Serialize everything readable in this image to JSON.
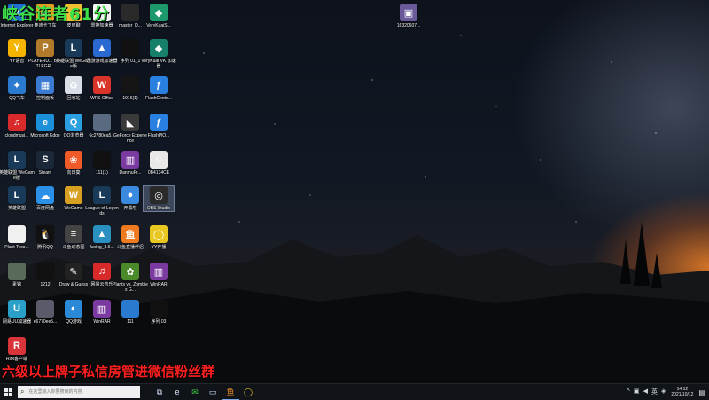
{
  "overlay": {
    "title": "峡谷连者61分",
    "banner": "六级以上牌子私信房管进微信粉丝群"
  },
  "desktop_icons": [
    {
      "label": "Internet Explorer",
      "icon": "ie-icon",
      "color": "#1f6fd0",
      "glyph": "e"
    },
    {
      "label": "奥迪卡丁车",
      "icon": "kart-icon",
      "color": "#e0a020",
      "glyph": "◉"
    },
    {
      "label": "皮皮聊",
      "icon": "chat-icon",
      "color": "#f0c030",
      "glyph": "☺"
    },
    {
      "label": "雷神加速器",
      "icon": "thor-icon",
      "color": "#f5f5f5",
      "glyph": "⚡"
    },
    {
      "label": "master_D...",
      "icon": "file-icon",
      "color": "#2a2a2a",
      "glyph": ""
    },
    {
      "label": "VeryKuaiS...",
      "icon": "verykuai-icon",
      "color": "#1d9a6c",
      "glyph": "◆"
    },
    {
      "label": "YY语音",
      "icon": "yy-icon",
      "color": "#f4b400",
      "glyph": "Y"
    },
    {
      "label": "PLAYERU... BATTLEGR...",
      "icon": "pubg-icon",
      "color": "#b07a2a",
      "glyph": "P"
    },
    {
      "label": "英雄联盟 WeGame版",
      "icon": "lol-icon",
      "color": "#1a3a5a",
      "glyph": "L"
    },
    {
      "label": "迅游游戏加速器",
      "icon": "xunyou-icon",
      "color": "#2a6ad0",
      "glyph": "▲"
    },
    {
      "label": "序列 01_1",
      "icon": "video-icon",
      "color": "#111111",
      "glyph": ""
    },
    {
      "label": "VeryKuai VK 加速器",
      "icon": "vk-icon",
      "color": "#17806a",
      "glyph": "◆"
    },
    {
      "label": "QQ飞车",
      "icon": "qqspeed-icon",
      "color": "#2a7ad0",
      "glyph": "✦"
    },
    {
      "label": "控制面板",
      "icon": "control-panel-icon",
      "color": "#3a7ad0",
      "glyph": "▦"
    },
    {
      "label": "回收站",
      "icon": "recycle-bin-icon",
      "color": "#d8dde6",
      "glyph": "♻"
    },
    {
      "label": "WPS Office",
      "icon": "wps-icon",
      "color": "#d8342a",
      "glyph": "W"
    },
    {
      "label": "1916(1)",
      "icon": "video-icon",
      "color": "#151515",
      "glyph": ""
    },
    {
      "label": "FlashCente...",
      "icon": "flash-icon",
      "color": "#2a80e0",
      "glyph": "ƒ"
    },
    {
      "label": "cloudmusi...",
      "icon": "netease-music-icon",
      "color": "#d82a2a",
      "glyph": "♫"
    },
    {
      "label": "Microsoft Edge",
      "icon": "edge-icon",
      "color": "#1b8fd8",
      "glyph": "e"
    },
    {
      "label": "QQ浏览器",
      "icon": "qqbrowser-icon",
      "color": "#2aa0e0",
      "glyph": "Q"
    },
    {
      "label": "6c2780ea5...",
      "icon": "image-icon",
      "color": "#5a6a80",
      "glyph": ""
    },
    {
      "label": "GeForce Experience",
      "icon": "geforce-icon",
      "color": "#3a3a3a",
      "glyph": "◣"
    },
    {
      "label": "FlashPlQ...",
      "icon": "flash-icon",
      "color": "#2a80e0",
      "glyph": "ƒ"
    },
    {
      "label": "英雄联盟 WeGame版",
      "icon": "lol-icon",
      "color": "#1a3a5a",
      "glyph": "L"
    },
    {
      "label": "Steam",
      "icon": "steam-icon",
      "color": "#1b2838",
      "glyph": "S"
    },
    {
      "label": "向日葵",
      "icon": "sunlogin-icon",
      "color": "#f05a28",
      "glyph": "❀"
    },
    {
      "label": "111(1)",
      "icon": "video-icon",
      "color": "#111111",
      "glyph": ""
    },
    {
      "label": "DanmuPr...",
      "icon": "rar-icon",
      "color": "#7a3aa0",
      "glyph": "▥"
    },
    {
      "label": "0B4134CE",
      "icon": "image-icon",
      "color": "#e8e8e8",
      "glyph": "☺"
    },
    {
      "label": "英雄联盟",
      "icon": "lol-icon",
      "color": "#1a3a5a",
      "glyph": "L"
    },
    {
      "label": "百度网盘",
      "icon": "baidu-pan-icon",
      "color": "#2a90e8",
      "glyph": "☁"
    },
    {
      "label": "WeGame",
      "icon": "wegame-icon",
      "color": "#d8a020",
      "glyph": "W"
    },
    {
      "label": "League of Legends",
      "icon": "lol-icon",
      "color": "#1a3a5a",
      "glyph": "L"
    },
    {
      "label": "开黑啦",
      "icon": "kaiheila-icon",
      "color": "#3a8ae0",
      "glyph": "●"
    },
    {
      "label": "OBS Studio",
      "icon": "obs-icon",
      "color": "#2a2a2a",
      "glyph": "◎"
    },
    {
      "label": "Plant Tyco...",
      "icon": "file-icon",
      "color": "#f0f0f0",
      "glyph": ""
    },
    {
      "label": "腾讯QQ",
      "icon": "qq-icon",
      "color": "#111111",
      "glyph": "🐧"
    },
    {
      "label": "斗鱼动态图",
      "icon": "file-icon",
      "color": "#444444",
      "glyph": "≡"
    },
    {
      "label": "fuxing_3.6...",
      "icon": "app-icon",
      "color": "#2a90c0",
      "glyph": "▲"
    },
    {
      "label": "斗鱼直播伴侣",
      "icon": "douyu-icon",
      "color": "#f07a20",
      "glyph": "鱼"
    },
    {
      "label": "YY开播",
      "icon": "yy-live-icon",
      "color": "#e8c820",
      "glyph": "◯"
    },
    {
      "label": "素锦",
      "icon": "image-icon",
      "color": "#5a6a5a",
      "glyph": ""
    },
    {
      "label": "1212",
      "icon": "video-icon",
      "color": "#111111",
      "glyph": ""
    },
    {
      "label": "Draw & Guess",
      "icon": "draw-guess-icon",
      "color": "#222222",
      "glyph": "✎"
    },
    {
      "label": "网易云音乐",
      "icon": "netease-music-icon",
      "color": "#d82a2a",
      "glyph": "♫"
    },
    {
      "label": "Plants vs. Zombies G...",
      "icon": "pvz-icon",
      "color": "#4a8a2a",
      "glyph": "✿"
    },
    {
      "label": "WinRAR",
      "icon": "rar-icon",
      "color": "#7a3aa0",
      "glyph": "▥"
    },
    {
      "label": "网易UU加速器",
      "icon": "uu-icon",
      "color": "#2aa0c8",
      "glyph": "U"
    },
    {
      "label": "e6770ee5...",
      "icon": "image-icon",
      "color": "#5a5a6a",
      "glyph": ""
    },
    {
      "label": "QQ游戏",
      "icon": "qqgame-icon",
      "color": "#2a8ad8",
      "glyph": "◐"
    },
    {
      "label": "WinRAR",
      "icon": "rar-icon",
      "color": "#7a3aa0",
      "glyph": "▥"
    },
    {
      "label": "111",
      "icon": "video-icon",
      "color": "#2a7ad0",
      "glyph": ""
    },
    {
      "label": "序列 03",
      "icon": "video-icon",
      "color": "#111111",
      "glyph": ""
    },
    {
      "label": "Riot客户端",
      "icon": "riot-icon",
      "color": "#d8343a",
      "glyph": "R"
    },
    {
      "label": "16320607...",
      "icon": "image-icon",
      "color": "#6a5a9a",
      "glyph": "▣"
    }
  ],
  "taskbar": {
    "search_placeholder": "在这里输入你要搜索的内容",
    "apps": [
      {
        "icon": "task-view-icon",
        "glyph": "⧉",
        "active": false
      },
      {
        "icon": "edge-icon",
        "glyph": "e",
        "active": false
      },
      {
        "icon": "wechat-icon",
        "glyph": "✉",
        "active": false
      },
      {
        "icon": "file-explorer-icon",
        "glyph": "▭",
        "active": false
      },
      {
        "icon": "douyu-icon",
        "glyph": "鱼",
        "active": true
      },
      {
        "icon": "yy-live-icon",
        "glyph": "◯",
        "active": false
      }
    ],
    "tray_icons": [
      "chevron-up-icon",
      "network-icon",
      "volume-icon",
      "ime-icon",
      "antivirus-icon"
    ],
    "time": "14:12",
    "date": "2021/10/12"
  }
}
